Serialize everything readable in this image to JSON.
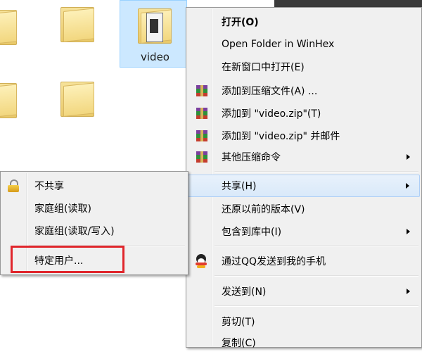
{
  "explorer": {
    "selected_folder_name": "video"
  },
  "context_menu": {
    "items": [
      {
        "label": "打开(O)",
        "bold": true
      },
      {
        "label": "Open Folder in WinHex"
      },
      {
        "label": "在新窗口中打开(E)"
      },
      {
        "label": "添加到压缩文件(A) ...",
        "icon": "winrar-icon"
      },
      {
        "label": "添加到 \"video.zip\"(T)",
        "icon": "winrar-icon"
      },
      {
        "label": "添加到 \"video.zip\" 并邮件",
        "icon": "winrar-icon"
      },
      {
        "label": "其他压缩命令",
        "icon": "winrar-icon",
        "submenu": true
      },
      {
        "label": "共享(H)",
        "submenu": true,
        "highlighted": true
      },
      {
        "label": "还原以前的版本(V)"
      },
      {
        "label": "包含到库中(I)",
        "submenu": true
      },
      {
        "label": "通过QQ发送到我的手机",
        "icon": "qq-icon"
      },
      {
        "label": "发送到(N)",
        "submenu": true
      },
      {
        "label": "剪切(T)"
      },
      {
        "label": "复制(C)"
      }
    ]
  },
  "share_submenu": {
    "items": [
      {
        "label": "不共享",
        "icon": "lock-icon"
      },
      {
        "label": "家庭组(读取)"
      },
      {
        "label": "家庭组(读取/写入)"
      },
      {
        "label": "特定用户...",
        "highlighted": true
      }
    ]
  },
  "colors": {
    "menu_bg": "#f0f0f0",
    "hover_bg": "#d9e9fa",
    "annotation_red": "#e0262c",
    "folder_yellow": "#f2d77f"
  }
}
